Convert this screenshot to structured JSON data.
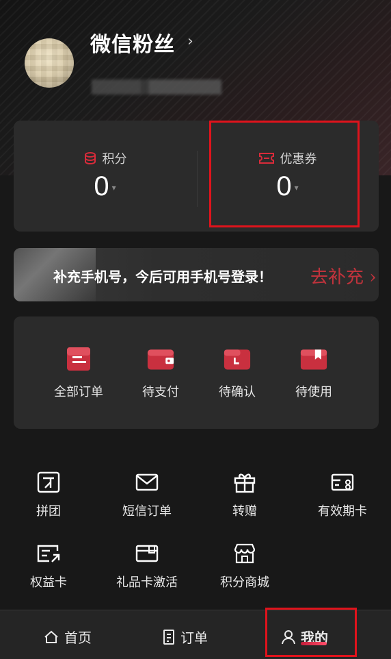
{
  "profile": {
    "name": "微信粉丝",
    "chevron": "›"
  },
  "stats": {
    "points": {
      "label": "积分",
      "value": "0",
      "icon": "points-coin-icon"
    },
    "coupons": {
      "label": "优惠券",
      "value": "0",
      "icon": "ticket-icon"
    }
  },
  "banner": {
    "text": "补充手机号，今后可用手机号登录！",
    "cta": "去补充 ›"
  },
  "orders": [
    {
      "label": "全部订单",
      "icon": "all-orders-icon"
    },
    {
      "label": "待支付",
      "icon": "wallet-icon"
    },
    {
      "label": "待确认",
      "icon": "clock-card-icon"
    },
    {
      "label": "待使用",
      "icon": "bookmark-icon"
    }
  ],
  "services": [
    {
      "label": "拼团",
      "icon": "group-buy-icon"
    },
    {
      "label": "短信订单",
      "icon": "mail-icon"
    },
    {
      "label": "转赠",
      "icon": "gift-icon"
    },
    {
      "label": "有效期卡",
      "icon": "validity-card-icon"
    },
    {
      "label": "权益卡",
      "icon": "benefit-card-icon"
    },
    {
      "label": "礼品卡激活",
      "icon": "gift-card-icon"
    },
    {
      "label": "积分商城",
      "icon": "shop-icon"
    }
  ],
  "tabs": [
    {
      "label": "首页",
      "icon": "home-icon"
    },
    {
      "label": "订单",
      "icon": "order-doc-icon"
    },
    {
      "label": "我的",
      "icon": "user-icon"
    }
  ],
  "colors": {
    "accent": "#d92b3a",
    "highlight": "#e0131c",
    "background": "#181818",
    "card": "#2b2b2b"
  }
}
